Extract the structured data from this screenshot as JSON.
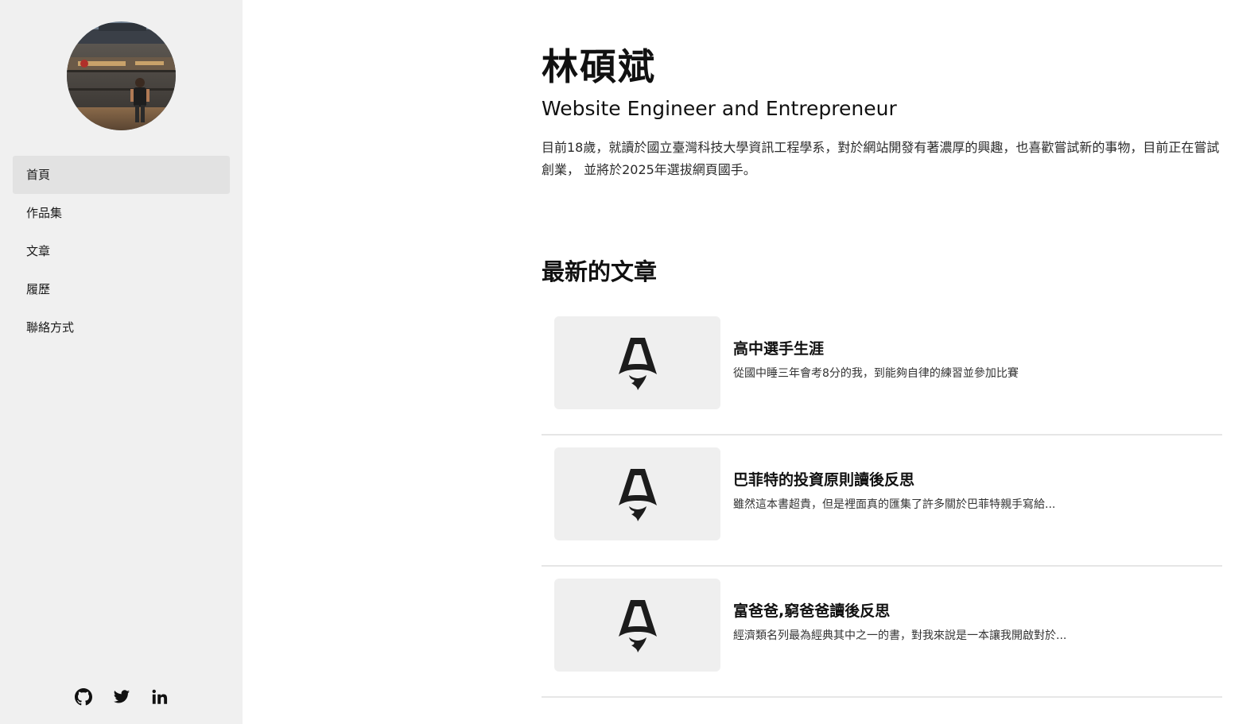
{
  "sidebar": {
    "avatar_alt": "林碩斌",
    "nav": [
      {
        "label": "首頁",
        "active": true
      },
      {
        "label": "作品集",
        "active": false
      },
      {
        "label": "文章",
        "active": false
      },
      {
        "label": "履歷",
        "active": false
      },
      {
        "label": "聯絡方式",
        "active": false
      }
    ],
    "social": [
      {
        "icon": "github-icon"
      },
      {
        "icon": "twitter-icon"
      },
      {
        "icon": "linkedin-icon"
      }
    ]
  },
  "main": {
    "name": "林碩斌",
    "subtitle": "Website Engineer and Entrepreneur",
    "bio": "目前18歲，就讀於國立臺灣科技大學資訊工程學系，對於網站開發有著濃厚的興趣，也喜歡嘗試新的事物，目前正在嘗試創業， 並將於2025年選拔網頁國手。",
    "latest_title": "最新的文章",
    "articles": [
      {
        "title": "高中選手生涯",
        "excerpt": "從國中睡三年會考8分的我，到能夠自律的練習並參加比賽",
        "thumb_icon": "astro-rocket-icon"
      },
      {
        "title": "巴菲特的投資原則讀後反思",
        "excerpt": "雖然這本書超貴，但是裡面真的匯集了許多關於巴菲特親手寫給...",
        "thumb_icon": "astro-rocket-icon"
      },
      {
        "title": "富爸爸,窮爸爸讀後反思",
        "excerpt": "經濟類名列最為經典其中之一的書，對我來說是一本讓我開啟對於...",
        "thumb_icon": "astro-rocket-icon"
      }
    ]
  },
  "colors": {
    "sidebar_bg": "#f0f0f0",
    "nav_active_bg": "#e2e2e2",
    "thumb_bg": "#efefef",
    "divider": "#e6e6e6",
    "text": "#111111"
  }
}
